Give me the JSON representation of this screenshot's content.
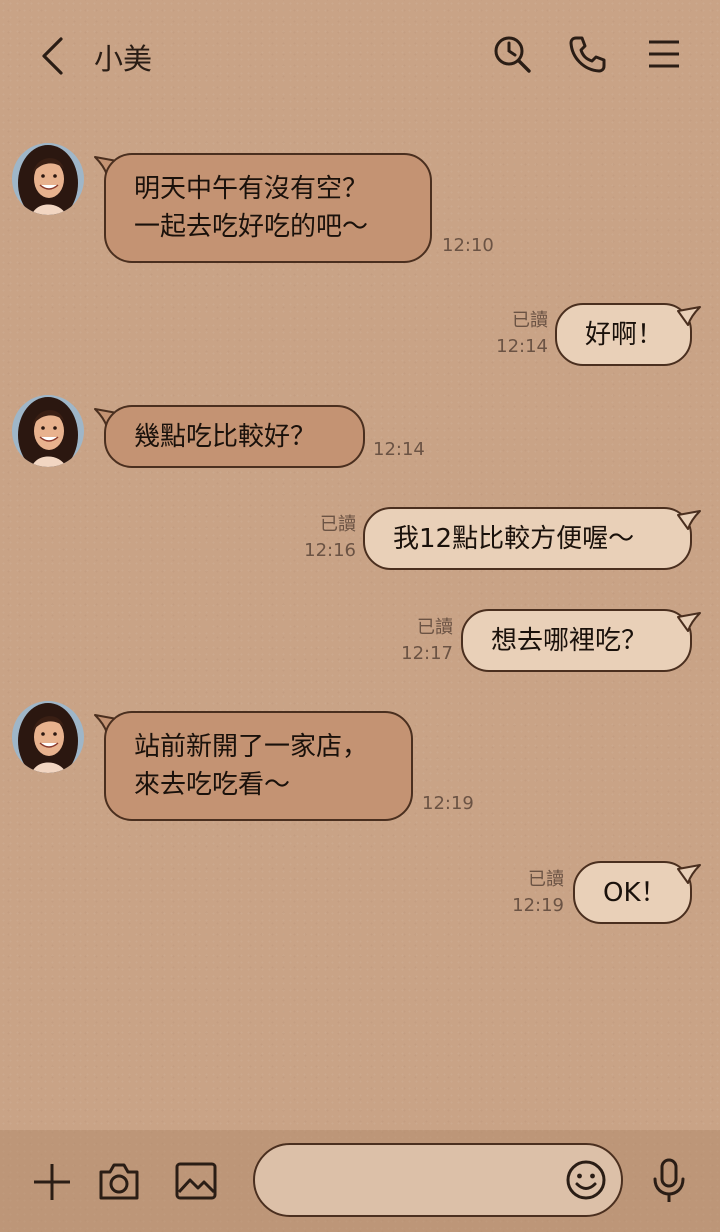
{
  "header": {
    "contact_name": "小美",
    "icons": [
      "back-chevron-icon",
      "search-clock-icon",
      "phone-icon",
      "menu-icon"
    ]
  },
  "messages": [
    {
      "side": "in",
      "lines": [
        "明天中午有沒有空？",
        "一起去吃好吃的吧～"
      ],
      "time": "12:10"
    },
    {
      "side": "out",
      "lines": [
        "好啊！"
      ],
      "time": "12:14",
      "read": "已讀"
    },
    {
      "side": "in",
      "lines": [
        "幾點吃比較好？"
      ],
      "time": "12:14"
    },
    {
      "side": "out",
      "lines": [
        "我12點比較方便喔～"
      ],
      "time": "12:16",
      "read": "已讀"
    },
    {
      "side": "out",
      "lines": [
        "想去哪裡吃？"
      ],
      "time": "12:17",
      "read": "已讀"
    },
    {
      "side": "in",
      "lines": [
        "站前新開了一家店，",
        "來去吃吃看～"
      ],
      "time": "12:19"
    },
    {
      "side": "out",
      "lines": [
        "OK！"
      ],
      "time": "12:19",
      "read": "已讀"
    }
  ],
  "composer": {
    "placeholder": "",
    "icons": [
      "plus-icon",
      "camera-icon",
      "image-icon",
      "emoji-icon",
      "microphone-icon"
    ]
  },
  "colors": {
    "background": "#c9a386",
    "incoming_bubble": "#c49373",
    "outgoing_bubble": "#e9d0b8",
    "bubble_border": "#4a2f1f"
  }
}
